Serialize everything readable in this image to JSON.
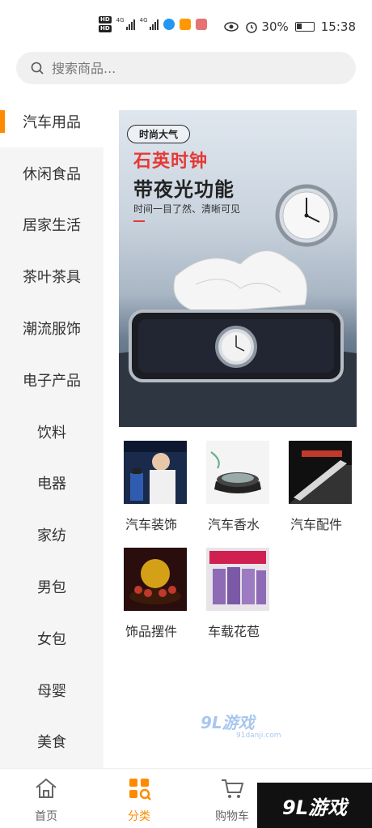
{
  "status_bar": {
    "battery": "30%",
    "time": "15:38",
    "net1": "4G",
    "net2": "4G"
  },
  "search": {
    "placeholder": "搜索商品..."
  },
  "sidebar": {
    "items": [
      {
        "label": "汽车用品",
        "active": true
      },
      {
        "label": "休闲食品"
      },
      {
        "label": "居家生活"
      },
      {
        "label": "茶叶茶具"
      },
      {
        "label": "潮流服饰"
      },
      {
        "label": "电子产品"
      },
      {
        "label": "饮料"
      },
      {
        "label": "电器"
      },
      {
        "label": "家纺"
      },
      {
        "label": "男包"
      },
      {
        "label": "女包"
      },
      {
        "label": "母婴"
      },
      {
        "label": "美食"
      }
    ]
  },
  "banner": {
    "tag": "时尚大气",
    "title_red": "石英时钟",
    "title_black": "带夜光功能",
    "subtitle": "时间一目了然、清晰可见"
  },
  "products": [
    {
      "label": "汽车装饰",
      "icon": "car-decoration-thumb"
    },
    {
      "label": "汽车香水",
      "icon": "car-perfume-thumb"
    },
    {
      "label": "汽车配件",
      "icon": "car-parts-thumb"
    },
    {
      "label": "饰品摆件",
      "icon": "ornament-thumb"
    },
    {
      "label": "车载花苞",
      "icon": "car-flower-thumb"
    }
  ],
  "watermark": {
    "brand": "9L游戏",
    "site": "91danji.com"
  },
  "bottom_nav": {
    "items": [
      {
        "label": "首页",
        "icon": "home-icon"
      },
      {
        "label": "分类",
        "icon": "category-icon",
        "active": true
      },
      {
        "label": "购物车",
        "icon": "cart-icon"
      }
    ]
  },
  "colors": {
    "accent": "#ff8a00",
    "sidebar_bg": "#f5f5f5"
  }
}
